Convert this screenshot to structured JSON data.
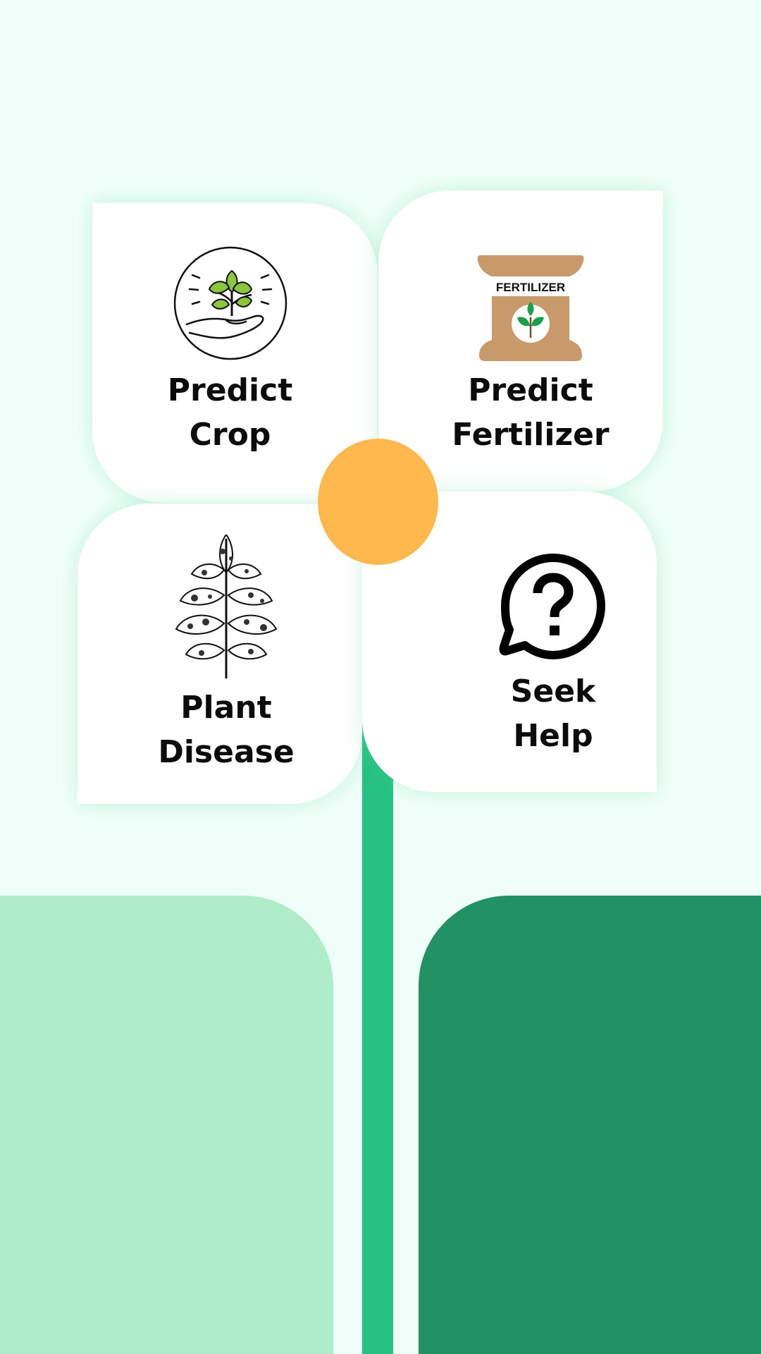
{
  "menu": {
    "predict_crop": {
      "line1": "Predict",
      "line2": "Crop",
      "icon": "seedling-in-hand-icon"
    },
    "predict_fertilizer": {
      "line1": "Predict",
      "line2": "Fertilizer",
      "icon": "fertilizer-bag-icon",
      "bag_text": "FERTILIZER"
    },
    "plant_disease": {
      "line1": "Plant",
      "line2": "Disease",
      "icon": "diseased-leaf-icon"
    },
    "seek_help": {
      "line1": "Seek",
      "line2": "Help",
      "icon": "help-chat-icon"
    }
  },
  "colors": {
    "background": "#f0fef9",
    "stem": "#27c283",
    "leaf_light": "#afedca",
    "leaf_dark": "#239166",
    "center": "#ffb84d",
    "card": "#ffffff"
  }
}
